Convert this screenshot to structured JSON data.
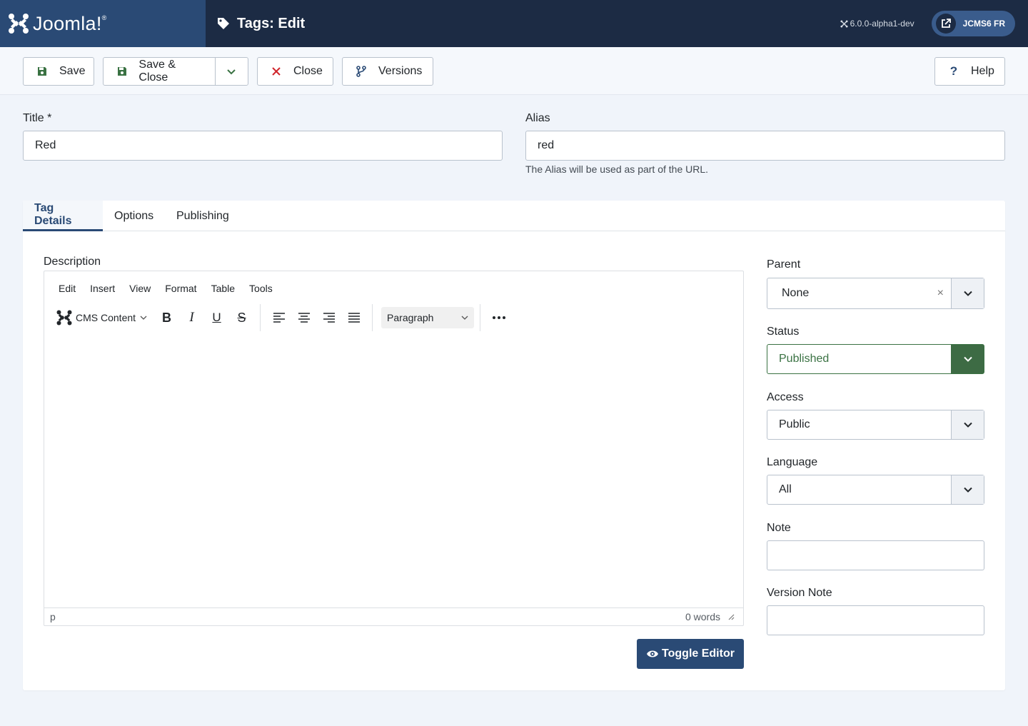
{
  "header": {
    "brand": "Joomla!",
    "brand_mark": "®",
    "title": "Tags: Edit",
    "version": "6.0.0-alpha1-dev",
    "site_button": "JCMS6 FR"
  },
  "toolbar": {
    "save": "Save",
    "save_close": "Save & Close",
    "close": "Close",
    "versions": "Versions",
    "help": "Help"
  },
  "form": {
    "title_label": "Title *",
    "title_value": "Red",
    "alias_label": "Alias",
    "alias_value": "red",
    "alias_hint": "The Alias will be used as part of the URL."
  },
  "tabs": [
    "Tag Details",
    "Options",
    "Publishing"
  ],
  "editor": {
    "label": "Description",
    "menu": [
      "Edit",
      "Insert",
      "View",
      "Format",
      "Table",
      "Tools"
    ],
    "cms_content": "CMS Content",
    "block_format": "Paragraph",
    "path": "p",
    "word_count": "0 words",
    "toggle": "Toggle Editor"
  },
  "sidebar": {
    "parent_label": "Parent",
    "parent_value": "None",
    "parent_clear": "×",
    "status_label": "Status",
    "status_value": "Published",
    "access_label": "Access",
    "access_value": "Public",
    "language_label": "Language",
    "language_value": "All",
    "note_label": "Note",
    "note_value": "",
    "version_note_label": "Version Note",
    "version_note_value": ""
  },
  "colors": {
    "header_bg": "#1c2b44",
    "brand_bg": "#2a4a75",
    "primary": "#2a4a75",
    "success": "#3a7243",
    "danger": "#d0252b"
  }
}
